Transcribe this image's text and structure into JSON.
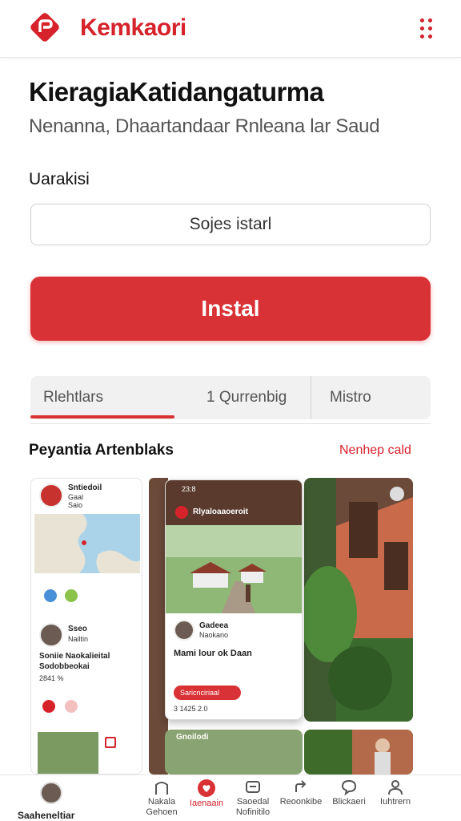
{
  "header": {
    "brand": "Kemkaori",
    "brand_color": "#d6222b",
    "logo_icon": "brand-logo-icon",
    "menu_icon": "more-dots-icon"
  },
  "app": {
    "title": "KieragiaKatidangaturma",
    "subtitle": "Nenanna, Dhaartandaar Rnleana lar Saud"
  },
  "form": {
    "label": "Uarakisi",
    "input_value": "Sojes istarl"
  },
  "install_button": {
    "label": "Instal",
    "color": "#d93236"
  },
  "tabs": [
    {
      "label": "Rlehtlars",
      "active": true
    },
    {
      "label": "1 Qurrenbig",
      "active": false
    },
    {
      "label": "Mistro",
      "active": false
    }
  ],
  "section": {
    "title": "Peyantia Artenblaks",
    "link": "Nenhep cald"
  },
  "screenshots": {
    "shot1": {
      "header_name": "Sntiedoil",
      "header_line2": "Gaal",
      "header_line3": "Saio",
      "post_author": "Sseo",
      "post_meta": "Nailtin",
      "post_title": "Soniie Naokalieital",
      "post_title2": "Sodobbeokai",
      "post_meta2": "2841 %"
    },
    "shot2": {
      "status": "23:8",
      "title": "Rlyaloaaoeroit",
      "author": "Gadeea",
      "author_meta": "Naokano",
      "caption": "Mami lour ok Daan",
      "button_label": "Saricnciriaal",
      "footer": "3 1425 2.0",
      "lower_label": "Gnoilodi"
    }
  },
  "bottom_nav": {
    "items": [
      {
        "label": "Saaheneltiar",
        "icon": "profile-avatar"
      },
      {
        "label": "Nakala",
        "label2": "Gehoen",
        "icon": "home-icon"
      },
      {
        "label": "Iaenaain",
        "icon": "heart-pin-icon",
        "active": true
      },
      {
        "label": "Saoedal",
        "label2": "Nofinitilo",
        "icon": "message-icon"
      },
      {
        "label": "Reoonkibe",
        "icon": "share-icon"
      },
      {
        "label": "Blickaeri",
        "icon": "chat-icon"
      },
      {
        "label": "Iuhtrern",
        "icon": "user-icon"
      }
    ]
  }
}
